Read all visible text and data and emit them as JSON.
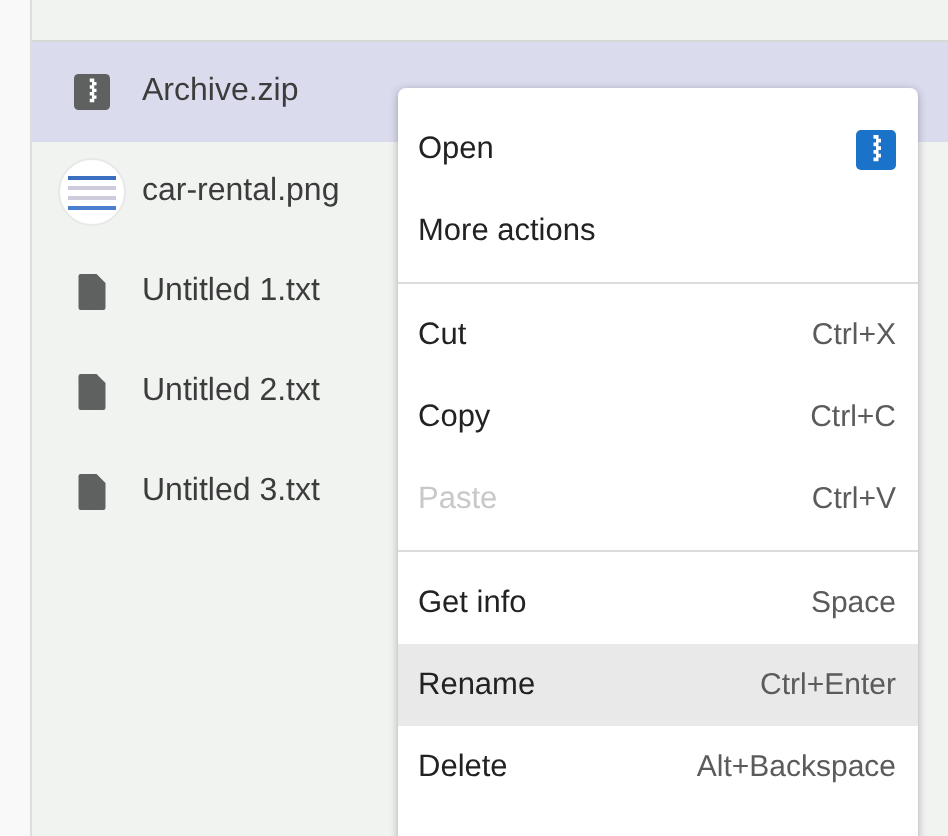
{
  "files": [
    {
      "name": "Archive.zip",
      "kind": "archive",
      "selected": true
    },
    {
      "name": "car-rental.png",
      "kind": "image",
      "selected": false
    },
    {
      "name": "Untitled 1.txt",
      "kind": "text",
      "selected": false
    },
    {
      "name": "Untitled 2.txt",
      "kind": "text",
      "selected": false
    },
    {
      "name": "Untitled 3.txt",
      "kind": "text",
      "selected": false
    }
  ],
  "context_menu": {
    "groups": [
      [
        {
          "label": "Open",
          "kind": "app",
          "disabled": false,
          "selected": false
        },
        {
          "label": "More actions",
          "kind": "plain",
          "disabled": false,
          "selected": false
        }
      ],
      [
        {
          "label": "Cut",
          "kind": "command",
          "shortcut": "Ctrl+X",
          "disabled": false,
          "selected": false
        },
        {
          "label": "Copy",
          "kind": "command",
          "shortcut": "Ctrl+C",
          "disabled": false,
          "selected": false
        },
        {
          "label": "Paste",
          "kind": "command",
          "shortcut": "Ctrl+V",
          "disabled": true,
          "selected": false
        }
      ],
      [
        {
          "label": "Get info",
          "kind": "command",
          "shortcut": "Space",
          "disabled": false,
          "selected": false
        },
        {
          "label": "Rename",
          "kind": "command",
          "shortcut": "Ctrl+Enter",
          "disabled": false,
          "selected": true
        },
        {
          "label": "Delete",
          "kind": "command",
          "shortcut": "Alt+Backspace",
          "disabled": false,
          "selected": false
        }
      ]
    ]
  }
}
